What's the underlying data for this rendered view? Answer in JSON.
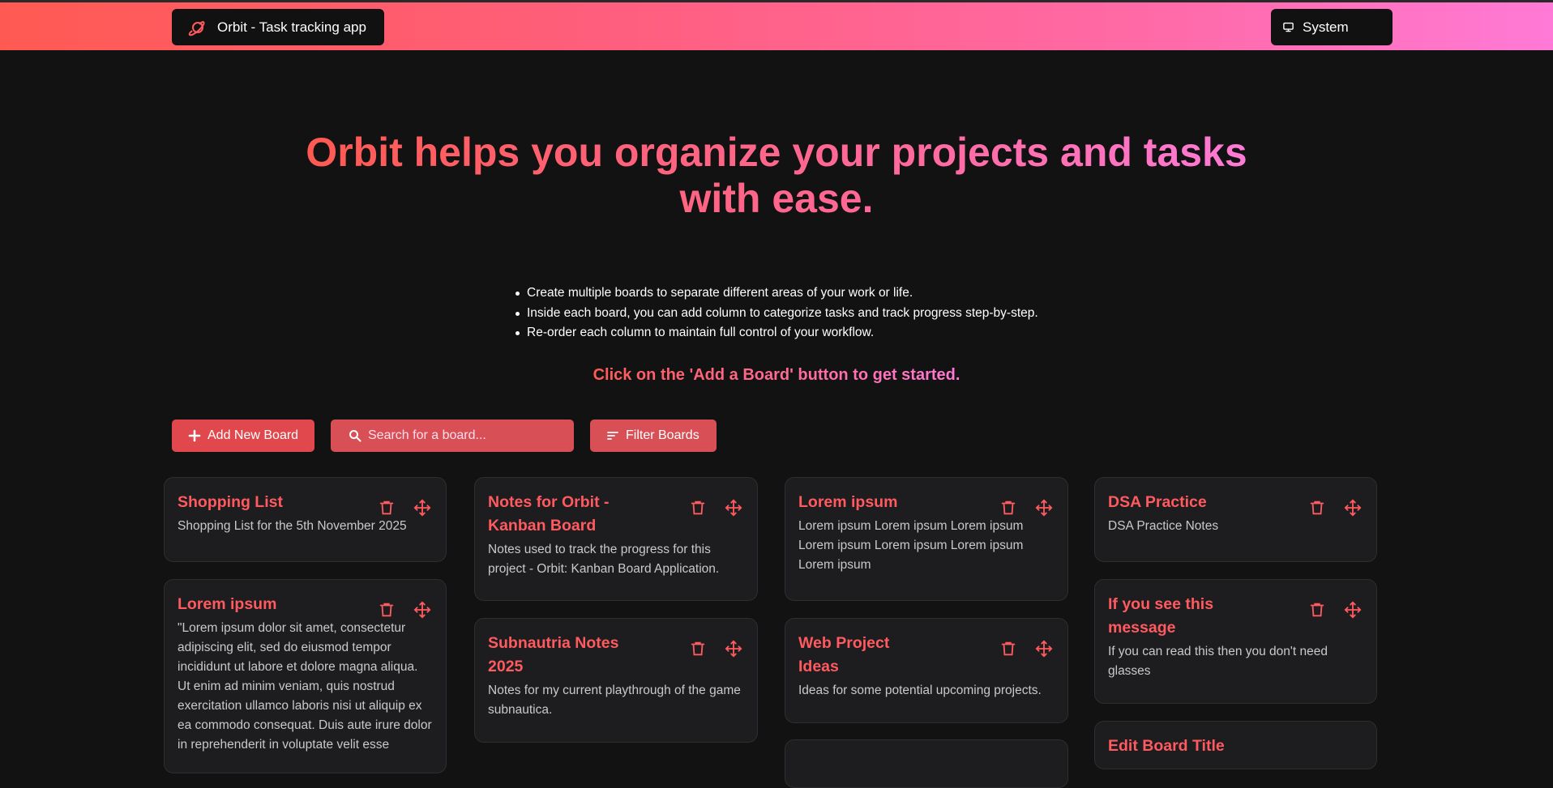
{
  "header": {
    "app_title": "Orbit - Task tracking app",
    "theme_label": "System"
  },
  "hero": {
    "line1": "Orbit helps you organize your projects and tasks",
    "line2": "with ease."
  },
  "features": [
    "Create multiple boards to separate different areas of your work or life.",
    "Inside each board, you can add column to categorize tasks and track progress step-by-step.",
    "Re-order each column to maintain full control of your workflow."
  ],
  "cta": "Click on the 'Add a Board' button to get started.",
  "toolbar": {
    "add_label": "Add New Board",
    "search_placeholder": "Search for a board...",
    "filter_label": "Filter Boards"
  },
  "boards": [
    {
      "title": "Shopping List",
      "desc": "Shopping List for the 5th November 2025"
    },
    {
      "title": "Notes for Orbit - Kanban Board",
      "desc": "Notes used to track the progress for this project - Orbit: Kanban Board Application."
    },
    {
      "title": "Lorem ipsum",
      "desc": "Lorem ipsum Lorem ipsum Lorem ipsum Lorem ipsum Lorem ipsum Lorem ipsum Lorem ipsum"
    },
    {
      "title": "DSA Practice",
      "desc": "DSA Practice Notes"
    },
    {
      "title": "Lorem ipsum",
      "desc": "\"Lorem ipsum dolor sit amet, consectetur adipiscing elit, sed do eiusmod tempor incididunt ut labore et dolore magna aliqua. Ut enim ad minim veniam, quis nostrud exercitation ullamco laboris nisi ut aliquip ex ea commodo consequat. Duis aute irure dolor in reprehenderit in voluptate velit esse"
    },
    {
      "title": "Subnautria Notes 2025",
      "desc": "Notes for my current playthrough of the game subnautica."
    },
    {
      "title": "Web Project Ideas",
      "desc": "Ideas for some potential upcoming projects."
    },
    {
      "title": "If you see this message",
      "desc": "If you can read this then you don't need glasses"
    },
    {
      "title": "Edit Board Title",
      "desc": ""
    }
  ],
  "colors": {
    "accent": "#ff5a5f",
    "gradient_start": "#ff5a52",
    "gradient_end": "#ff7ad6",
    "card_bg": "#1d1d1f",
    "page_bg": "#121212"
  }
}
